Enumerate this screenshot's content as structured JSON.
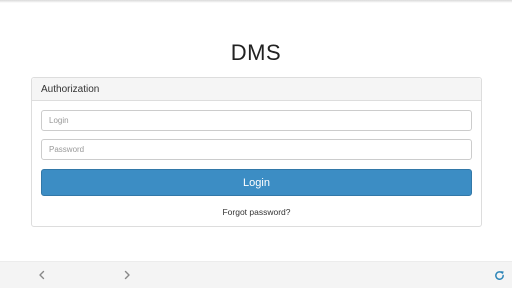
{
  "app": {
    "title": "DMS"
  },
  "auth": {
    "header": "Authorization",
    "login_placeholder": "Login",
    "password_placeholder": "Password",
    "login_value": "",
    "password_value": "",
    "login_button": "Login",
    "forgot_password": "Forgot password?"
  },
  "colors": {
    "accent": "#3c8dc4",
    "refresh_icon": "#2c85b8"
  },
  "bottom_bar": {
    "icons": [
      "chevron-left-icon",
      "chevron-right-icon",
      "refresh-icon"
    ]
  }
}
